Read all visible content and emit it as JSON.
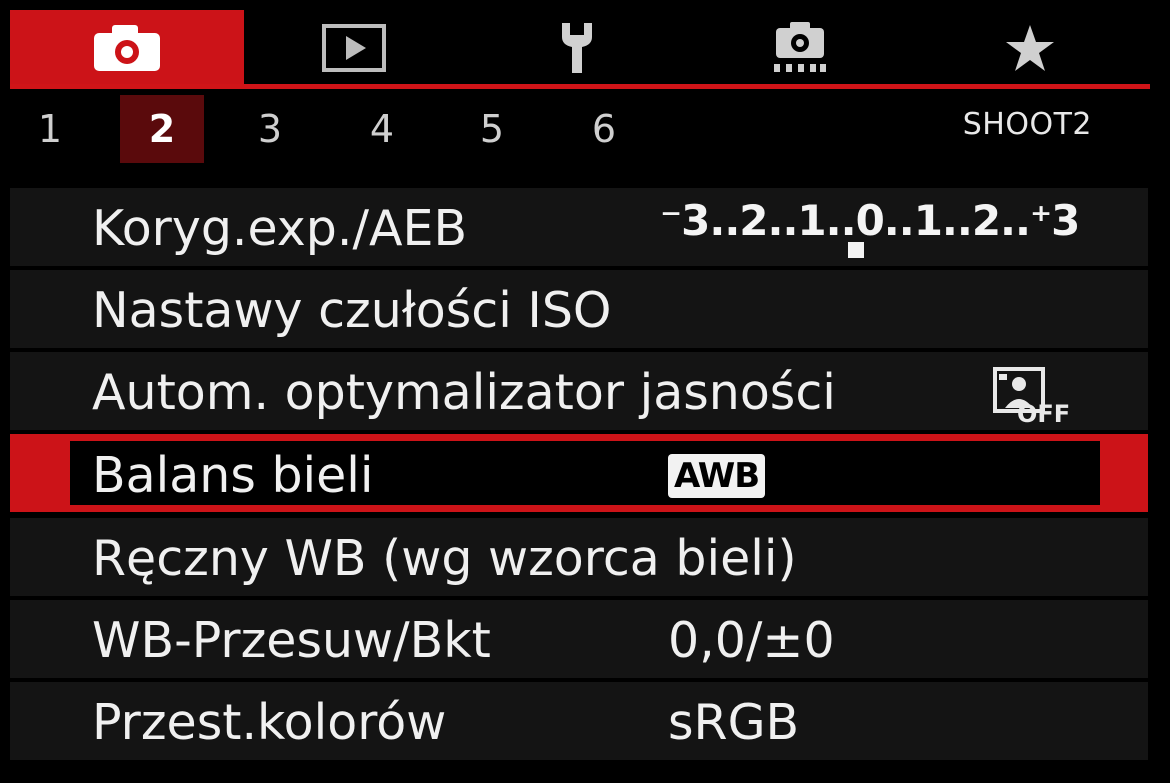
{
  "tabs": [
    {
      "icon": "camera-icon",
      "active": true
    },
    {
      "icon": "playback-icon",
      "active": false
    },
    {
      "icon": "wrench-icon",
      "active": false
    },
    {
      "icon": "custom-function-camera-icon",
      "active": false
    },
    {
      "icon": "star-icon",
      "active": false
    }
  ],
  "pages": [
    "1",
    "2",
    "3",
    "4",
    "5",
    "6"
  ],
  "active_page": "2",
  "menu_title": "SHOOT2",
  "rows": [
    {
      "label": "Koryg.exp./AEB",
      "value": "⁻3..2..1..0..1..2..⁺3"
    },
    {
      "label": "Nastawy czułości ISO",
      "value": ""
    },
    {
      "label": "Autom. optymalizator jasności",
      "value_icon": "auto-lighting-optimizer-off-icon",
      "icon_text": "OFF"
    },
    {
      "label": "Balans bieli",
      "value": "AWB",
      "selected": true
    },
    {
      "label": "Ręczny WB (wg wzorca bieli)",
      "value": ""
    },
    {
      "label": "WB-Przesuw/Bkt",
      "value": "0,0/±0"
    },
    {
      "label": "Przest.kolorów",
      "value": "sRGB"
    }
  ],
  "colors": {
    "accent": "#cc1318",
    "background": "#000000",
    "row": "#141414",
    "text": "#f0f0f0"
  }
}
